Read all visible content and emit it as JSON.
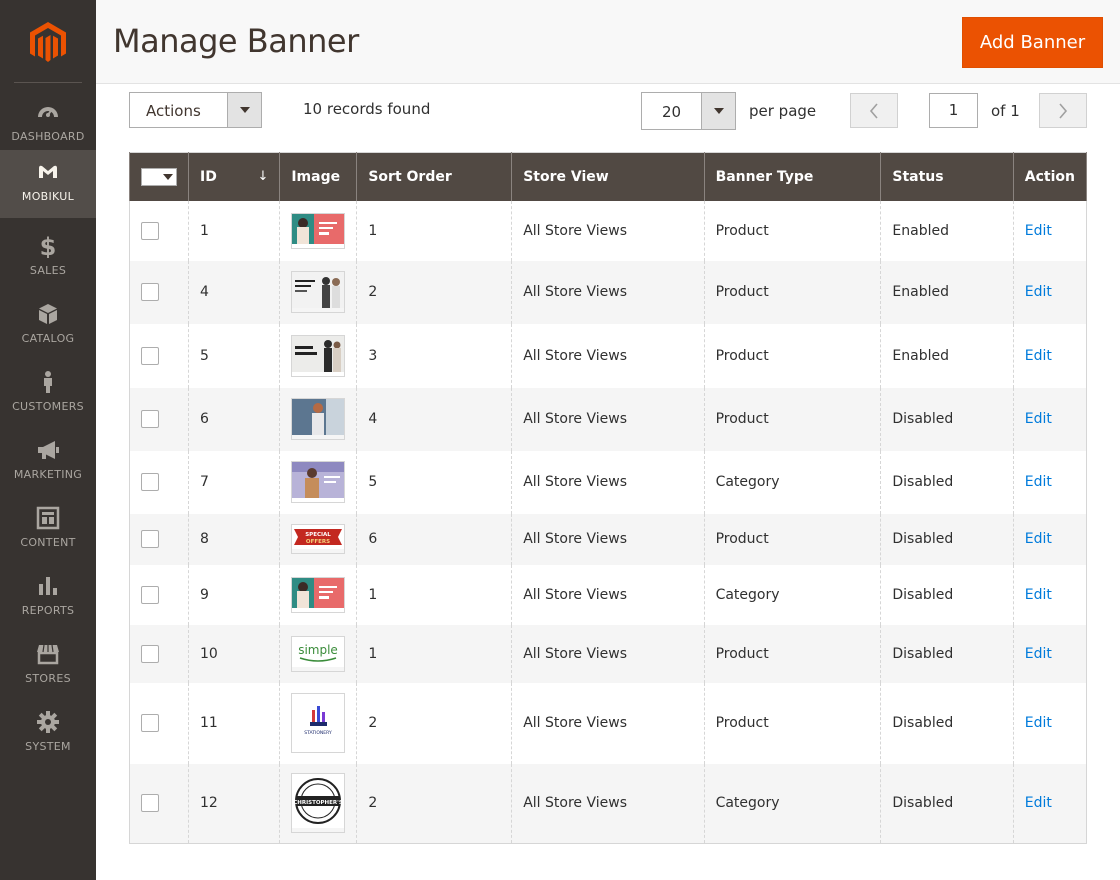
{
  "sidebar": {
    "items": [
      {
        "label": "DASHBOARD",
        "icon": "dashboard-icon"
      },
      {
        "label": "MOBIKUL",
        "icon": "mobikul-icon"
      },
      {
        "label": "SALES",
        "icon": "dollar-icon"
      },
      {
        "label": "CATALOG",
        "icon": "box-icon"
      },
      {
        "label": "CUSTOMERS",
        "icon": "person-icon"
      },
      {
        "label": "MARKETING",
        "icon": "megaphone-icon"
      },
      {
        "label": "CONTENT",
        "icon": "content-layout-icon"
      },
      {
        "label": "REPORTS",
        "icon": "bar-chart-icon"
      },
      {
        "label": "STORES",
        "icon": "store-icon"
      },
      {
        "label": "SYSTEM",
        "icon": "gear-icon"
      }
    ],
    "active": "MOBIKUL"
  },
  "header": {
    "title": "Manage Banner",
    "add_button": "Add Banner"
  },
  "toolbar": {
    "actions_label": "Actions",
    "records_found": "10 records found",
    "per_page_value": "20",
    "per_page_label": "per page",
    "page_current": "1",
    "page_total_label": "of 1"
  },
  "grid": {
    "columns": [
      "ID",
      "Image",
      "Sort Order",
      "Store View",
      "Banner Type",
      "Status",
      "Action"
    ],
    "sort_indicator": "↓",
    "rows": [
      {
        "id": "1",
        "sort_order": "1",
        "store_view": "All Store Views",
        "banner_type": "Product",
        "status": "Enabled",
        "action": "Edit",
        "thumb": "fashion-red"
      },
      {
        "id": "4",
        "sort_order": "2",
        "store_view": "All Store Views",
        "banner_type": "Product",
        "status": "Enabled",
        "action": "Edit",
        "thumb": "fashion-white"
      },
      {
        "id": "5",
        "sort_order": "3",
        "store_view": "All Store Views",
        "banner_type": "Product",
        "status": "Enabled",
        "action": "Edit",
        "thumb": "new-collection"
      },
      {
        "id": "6",
        "sort_order": "4",
        "store_view": "All Store Views",
        "banner_type": "Product",
        "status": "Disabled",
        "action": "Edit",
        "thumb": "woman-blue"
      },
      {
        "id": "7",
        "sort_order": "5",
        "store_view": "All Store Views",
        "banner_type": "Category",
        "status": "Disabled",
        "action": "Edit",
        "thumb": "man-purple"
      },
      {
        "id": "8",
        "sort_order": "6",
        "store_view": "All Store Views",
        "banner_type": "Product",
        "status": "Disabled",
        "action": "Edit",
        "thumb": "special-offers"
      },
      {
        "id": "9",
        "sort_order": "1",
        "store_view": "All Store Views",
        "banner_type": "Category",
        "status": "Disabled",
        "action": "Edit",
        "thumb": "fashion-red"
      },
      {
        "id": "10",
        "sort_order": "1",
        "store_view": "All Store Views",
        "banner_type": "Product",
        "status": "Disabled",
        "action": "Edit",
        "thumb": "simple-logo"
      },
      {
        "id": "11",
        "sort_order": "2",
        "store_view": "All Store Views",
        "banner_type": "Product",
        "status": "Disabled",
        "action": "Edit",
        "thumb": "stationery-logo"
      },
      {
        "id": "12",
        "sort_order": "2",
        "store_view": "All Store Views",
        "banner_type": "Category",
        "status": "Disabled",
        "action": "Edit",
        "thumb": "christophers-logo"
      }
    ]
  },
  "thumb_text": {
    "special_offers": "SPECIAL OFFERS",
    "simple": "simple",
    "stationery": "STATIONERY",
    "christophers": "CHRISTOPHER'S"
  },
  "colors": {
    "sidebar_bg": "#373330",
    "sidebar_active": "#524d49",
    "accent": "#eb5202",
    "table_header": "#514943",
    "link": "#007bdb"
  }
}
